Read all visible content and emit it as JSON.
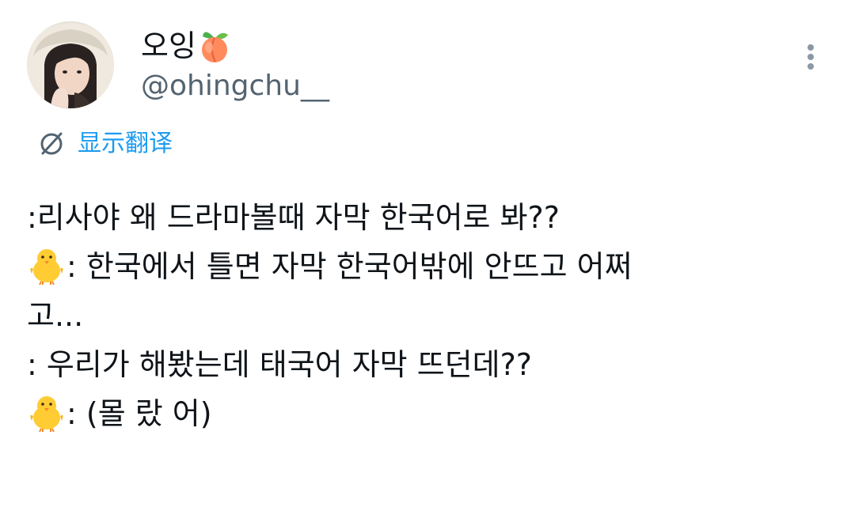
{
  "author": {
    "display_name": "오잉",
    "display_name_emoji": "peach-icon",
    "handle": "@ohingchu__",
    "avatar": "avatar"
  },
  "header": {
    "more_icon": "more-vertical-icon"
  },
  "translate": {
    "icon": "translate-icon",
    "label": "显示翻译",
    "color": "#1d9bf0"
  },
  "tweet": {
    "lines": [
      {
        "prefix_emoji": "",
        "text": ":리사야 왜 드라마볼때 자막 한국어로 봐??"
      },
      {
        "prefix_emoji": "chick-icon",
        "text": ": 한국에서 틀면 자막 한국어밖에 안뜨고 어쩌"
      },
      {
        "prefix_emoji": "",
        "text": "고..."
      },
      {
        "prefix_emoji": "",
        "text": ": 우리가 해봤는데 태국어 자막 뜨던데??"
      },
      {
        "prefix_emoji": "chick-icon",
        "text": ": (몰 랐 어)"
      }
    ]
  },
  "colors": {
    "text": "#0f1419",
    "secondary": "#536471",
    "accent": "#1d9bf0"
  }
}
